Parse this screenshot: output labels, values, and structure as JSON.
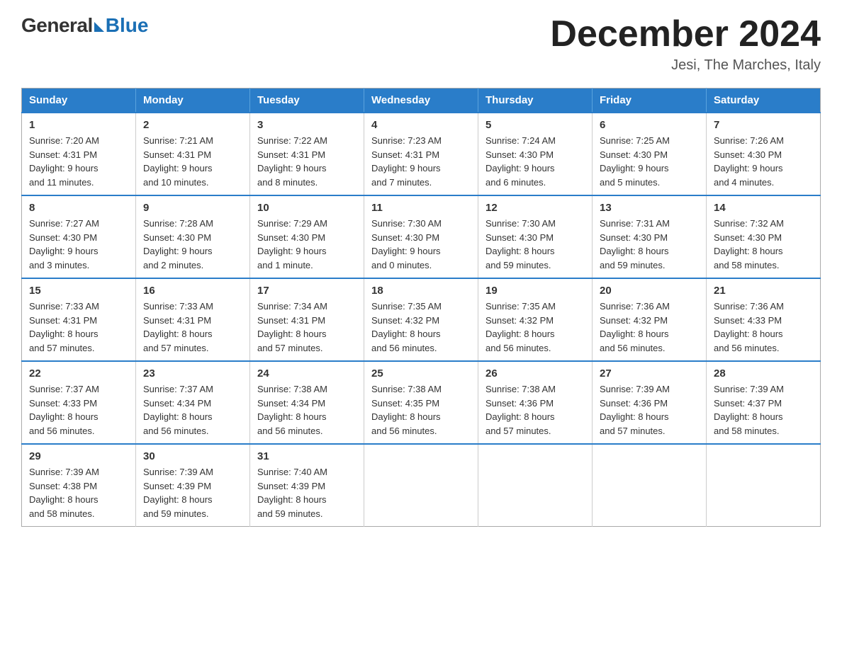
{
  "logo": {
    "general": "General",
    "blue": "Blue",
    "subtitle": ""
  },
  "title": {
    "month_year": "December 2024",
    "location": "Jesi, The Marches, Italy"
  },
  "header_days": [
    "Sunday",
    "Monday",
    "Tuesday",
    "Wednesday",
    "Thursday",
    "Friday",
    "Saturday"
  ],
  "weeks": [
    [
      {
        "day": "1",
        "sunrise": "7:20 AM",
        "sunset": "4:31 PM",
        "daylight": "9 hours and 11 minutes."
      },
      {
        "day": "2",
        "sunrise": "7:21 AM",
        "sunset": "4:31 PM",
        "daylight": "9 hours and 10 minutes."
      },
      {
        "day": "3",
        "sunrise": "7:22 AM",
        "sunset": "4:31 PM",
        "daylight": "9 hours and 8 minutes."
      },
      {
        "day": "4",
        "sunrise": "7:23 AM",
        "sunset": "4:31 PM",
        "daylight": "9 hours and 7 minutes."
      },
      {
        "day": "5",
        "sunrise": "7:24 AM",
        "sunset": "4:30 PM",
        "daylight": "9 hours and 6 minutes."
      },
      {
        "day": "6",
        "sunrise": "7:25 AM",
        "sunset": "4:30 PM",
        "daylight": "9 hours and 5 minutes."
      },
      {
        "day": "7",
        "sunrise": "7:26 AM",
        "sunset": "4:30 PM",
        "daylight": "9 hours and 4 minutes."
      }
    ],
    [
      {
        "day": "8",
        "sunrise": "7:27 AM",
        "sunset": "4:30 PM",
        "daylight": "9 hours and 3 minutes."
      },
      {
        "day": "9",
        "sunrise": "7:28 AM",
        "sunset": "4:30 PM",
        "daylight": "9 hours and 2 minutes."
      },
      {
        "day": "10",
        "sunrise": "7:29 AM",
        "sunset": "4:30 PM",
        "daylight": "9 hours and 1 minute."
      },
      {
        "day": "11",
        "sunrise": "7:30 AM",
        "sunset": "4:30 PM",
        "daylight": "9 hours and 0 minutes."
      },
      {
        "day": "12",
        "sunrise": "7:30 AM",
        "sunset": "4:30 PM",
        "daylight": "8 hours and 59 minutes."
      },
      {
        "day": "13",
        "sunrise": "7:31 AM",
        "sunset": "4:30 PM",
        "daylight": "8 hours and 59 minutes."
      },
      {
        "day": "14",
        "sunrise": "7:32 AM",
        "sunset": "4:30 PM",
        "daylight": "8 hours and 58 minutes."
      }
    ],
    [
      {
        "day": "15",
        "sunrise": "7:33 AM",
        "sunset": "4:31 PM",
        "daylight": "8 hours and 57 minutes."
      },
      {
        "day": "16",
        "sunrise": "7:33 AM",
        "sunset": "4:31 PM",
        "daylight": "8 hours and 57 minutes."
      },
      {
        "day": "17",
        "sunrise": "7:34 AM",
        "sunset": "4:31 PM",
        "daylight": "8 hours and 57 minutes."
      },
      {
        "day": "18",
        "sunrise": "7:35 AM",
        "sunset": "4:32 PM",
        "daylight": "8 hours and 56 minutes."
      },
      {
        "day": "19",
        "sunrise": "7:35 AM",
        "sunset": "4:32 PM",
        "daylight": "8 hours and 56 minutes."
      },
      {
        "day": "20",
        "sunrise": "7:36 AM",
        "sunset": "4:32 PM",
        "daylight": "8 hours and 56 minutes."
      },
      {
        "day": "21",
        "sunrise": "7:36 AM",
        "sunset": "4:33 PM",
        "daylight": "8 hours and 56 minutes."
      }
    ],
    [
      {
        "day": "22",
        "sunrise": "7:37 AM",
        "sunset": "4:33 PM",
        "daylight": "8 hours and 56 minutes."
      },
      {
        "day": "23",
        "sunrise": "7:37 AM",
        "sunset": "4:34 PM",
        "daylight": "8 hours and 56 minutes."
      },
      {
        "day": "24",
        "sunrise": "7:38 AM",
        "sunset": "4:34 PM",
        "daylight": "8 hours and 56 minutes."
      },
      {
        "day": "25",
        "sunrise": "7:38 AM",
        "sunset": "4:35 PM",
        "daylight": "8 hours and 56 minutes."
      },
      {
        "day": "26",
        "sunrise": "7:38 AM",
        "sunset": "4:36 PM",
        "daylight": "8 hours and 57 minutes."
      },
      {
        "day": "27",
        "sunrise": "7:39 AM",
        "sunset": "4:36 PM",
        "daylight": "8 hours and 57 minutes."
      },
      {
        "day": "28",
        "sunrise": "7:39 AM",
        "sunset": "4:37 PM",
        "daylight": "8 hours and 58 minutes."
      }
    ],
    [
      {
        "day": "29",
        "sunrise": "7:39 AM",
        "sunset": "4:38 PM",
        "daylight": "8 hours and 58 minutes."
      },
      {
        "day": "30",
        "sunrise": "7:39 AM",
        "sunset": "4:39 PM",
        "daylight": "8 hours and 59 minutes."
      },
      {
        "day": "31",
        "sunrise": "7:40 AM",
        "sunset": "4:39 PM",
        "daylight": "8 hours and 59 minutes."
      },
      null,
      null,
      null,
      null
    ]
  ],
  "labels": {
    "sunrise": "Sunrise:",
    "sunset": "Sunset:",
    "daylight": "Daylight:"
  }
}
